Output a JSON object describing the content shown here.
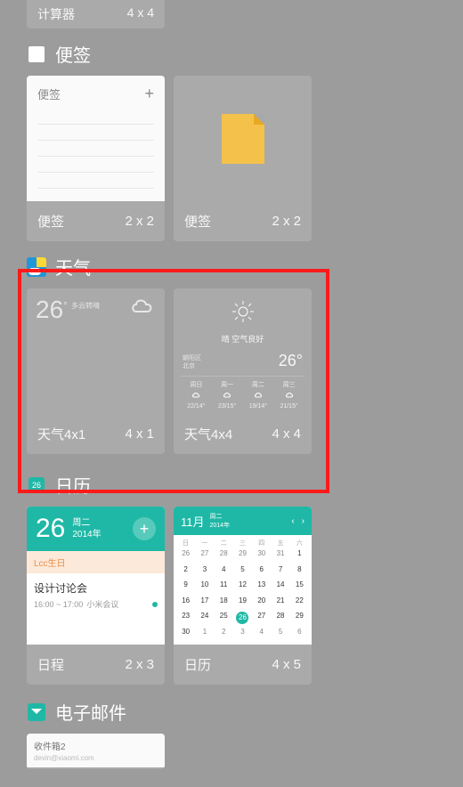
{
  "top_partial": {
    "name": "计算器",
    "size": "4 x 4"
  },
  "notes": {
    "section_title": "便签",
    "card1": {
      "preview_title": "便签",
      "name": "便签",
      "size": "2 x 2"
    },
    "card2": {
      "name": "便签",
      "size": "2 x 2"
    }
  },
  "weather": {
    "section_title": "天气",
    "card1": {
      "temp": "26",
      "deg": "°",
      "sub": "多云转晴",
      "name": "天气4x1",
      "size": "4 x 1"
    },
    "card2": {
      "desc": "晴 空气良好",
      "loc1": "朝阳区",
      "loc2": "北京",
      "bigtemp": "26°",
      "forecast": [
        {
          "d": "周日",
          "r": "22/14°"
        },
        {
          "d": "周一",
          "r": "23/15°"
        },
        {
          "d": "周二",
          "r": "19/14°"
        },
        {
          "d": "周三",
          "r": "21/15°"
        }
      ],
      "name": "天气4x4",
      "size": "4 x 4"
    }
  },
  "calendar": {
    "section_title": "日历",
    "schedule": {
      "day": "26",
      "weekday": "周二",
      "year": "2014年",
      "birthday": "Lcc生日",
      "event_title": "设计讨论会",
      "event_time": "16:00 ~ 17:00",
      "event_loc": "小米会议",
      "name": "日程",
      "size": "2 x 3"
    },
    "month": {
      "month_label": "11月",
      "month_sub": "周二\n2014年",
      "name": "日历",
      "size": "4 x 5",
      "headers": [
        "日",
        "一",
        "二",
        "三",
        "四",
        "五",
        "六"
      ],
      "days_prev": [
        "26",
        "27",
        "28",
        "29",
        "30",
        "31"
      ],
      "days": [
        "1",
        "2",
        "3",
        "4",
        "5",
        "6",
        "7",
        "8",
        "9",
        "10",
        "11",
        "12",
        "13",
        "14",
        "15",
        "16",
        "17",
        "18",
        "19",
        "20",
        "21",
        "22",
        "23",
        "24",
        "25",
        "26",
        "27",
        "28",
        "29",
        "30"
      ],
      "days_next": [
        "1",
        "2",
        "3",
        "4",
        "5",
        "6"
      ],
      "today": "26"
    }
  },
  "email": {
    "section_title": "电子邮件",
    "inbox_label": "收件箱2",
    "from": "devin@xiaomi.com"
  }
}
